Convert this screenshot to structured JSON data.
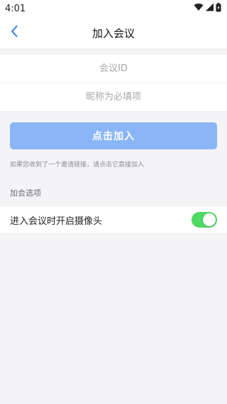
{
  "status_bar": {
    "time": "4:01",
    "icons": [
      "wifi-icon",
      "cell-signal-icon",
      "battery-icon"
    ]
  },
  "nav": {
    "title": "加入会议",
    "back_icon": "chevron-left-icon"
  },
  "form": {
    "meeting_id": {
      "placeholder": "会议ID",
      "value": ""
    },
    "nickname": {
      "placeholder": "昵称为必填项",
      "value": ""
    }
  },
  "join_button": {
    "label": "点击加入"
  },
  "hint": "如果您收到了一个邀请链接，请点击它直接加入",
  "options": {
    "section_title": "加会选项",
    "camera_label": "进入会议时开启摄像头",
    "camera_enabled": true
  },
  "colors": {
    "accent": "#2f7de1",
    "join_button": "#8ab6f8",
    "toggle_on": "#4cd964",
    "background": "#f4f4f6"
  }
}
